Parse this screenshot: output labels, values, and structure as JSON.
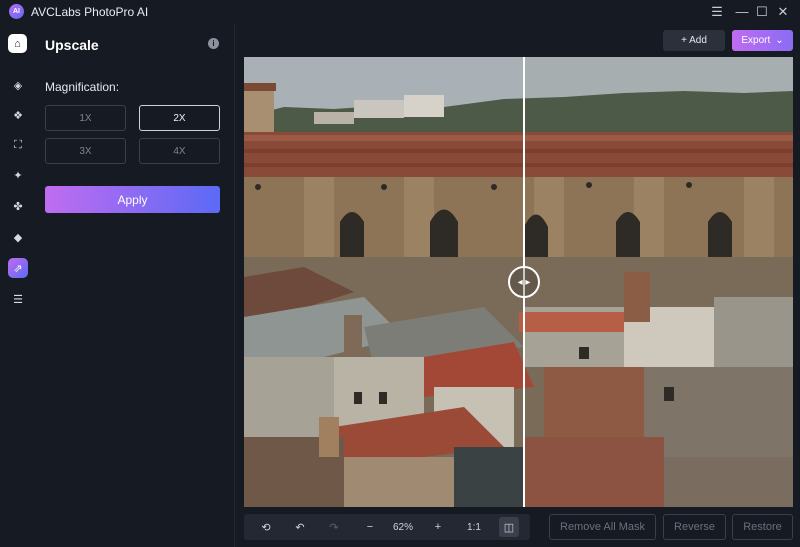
{
  "app": {
    "title": "AVCLabs PhotoPro AI",
    "logo_text": "AI"
  },
  "window_controls": {
    "menu": "☰",
    "minimize": "—",
    "maximize": "☐",
    "close": "✕"
  },
  "rail": {
    "items": [
      {
        "icon": "home-icon",
        "glyph": "⌂"
      },
      {
        "icon": "eraser-icon",
        "glyph": "◈"
      },
      {
        "icon": "replace-icon",
        "glyph": "❖"
      },
      {
        "icon": "expand-icon",
        "glyph": "⛶"
      },
      {
        "icon": "enhance-icon",
        "glyph": "✦"
      },
      {
        "icon": "fan-icon",
        "glyph": "✤"
      },
      {
        "icon": "fill-icon",
        "glyph": "◆"
      },
      {
        "icon": "upscale-icon",
        "glyph": "⇗"
      },
      {
        "icon": "adjust-icon",
        "glyph": "☰"
      }
    ]
  },
  "panel": {
    "title": "Upscale",
    "info": "i",
    "magnification_label": "Magnification:",
    "options": [
      "1X",
      "2X",
      "3X",
      "4X"
    ],
    "selected_option": "2X",
    "apply_label": "Apply"
  },
  "top_actions": {
    "add_label": "+ Add",
    "export_label": "Export",
    "export_chevron": "⌄"
  },
  "canvas": {
    "split_position": 0.51,
    "handle_glyph": "◂ ▸"
  },
  "toolbar": {
    "rotate": "⟲",
    "undo": "↶",
    "redo": "↷",
    "zoom_out": "−",
    "zoom_level": "62%",
    "zoom_in": "+",
    "actual_size": "1:1",
    "compare": "◫"
  },
  "actions": {
    "remove_all_mask": "Remove All Mask",
    "reverse": "Reverse",
    "restore": "Restore"
  },
  "colors": {
    "accent_start": "#c06cf0",
    "accent_end": "#5b6af5",
    "background": "#161a22"
  }
}
